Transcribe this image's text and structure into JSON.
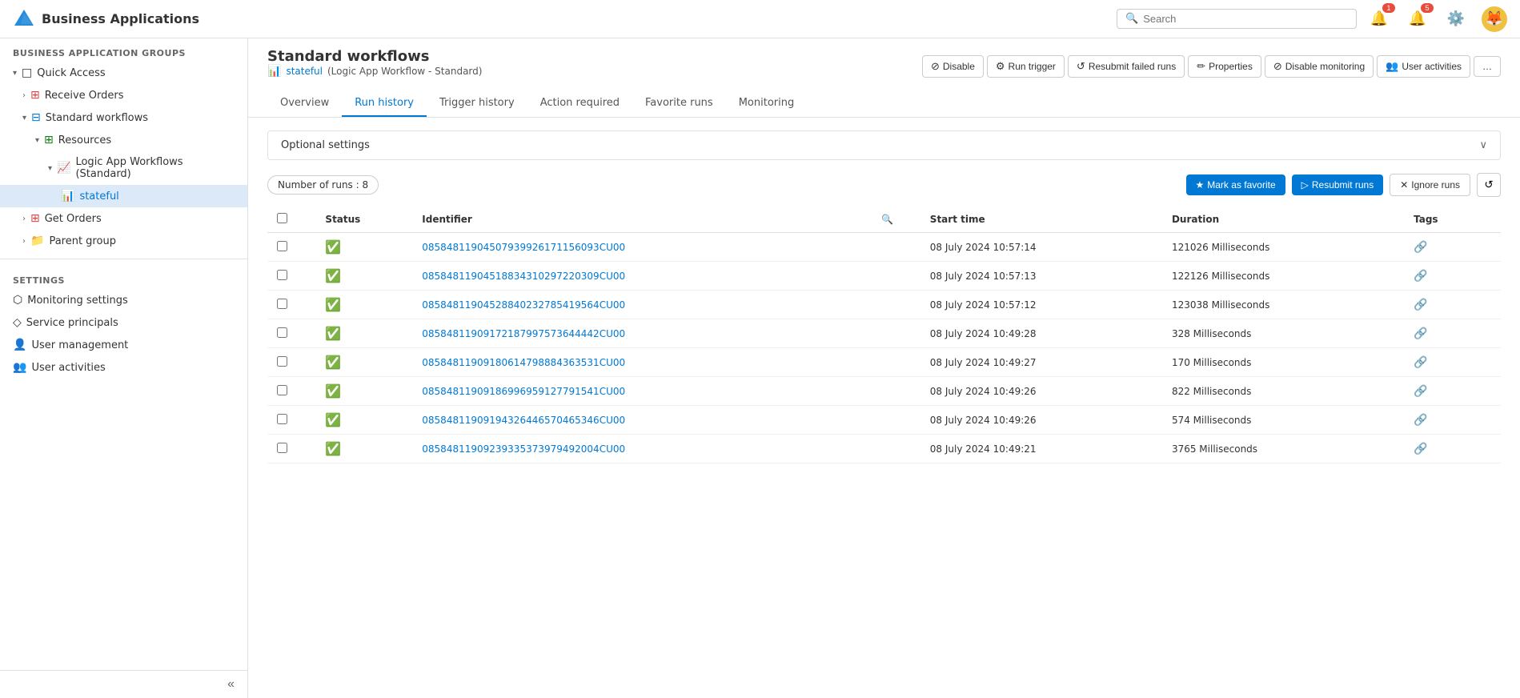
{
  "app": {
    "title": "Business Applications",
    "logo_emoji": "🔷"
  },
  "header": {
    "search_placeholder": "Search",
    "notification_badge": "1",
    "alert_badge": "5",
    "avatar_emoji": "🦊"
  },
  "sidebar": {
    "groups_title": "BUSINESS APPLICATION GROUPS",
    "quick_access_label": "Quick Access",
    "items": [
      {
        "label": "Receive Orders",
        "icon": "📊",
        "indent": 1,
        "expandable": false
      },
      {
        "label": "Standard workflows",
        "icon": "📋",
        "indent": 1,
        "expandable": true
      },
      {
        "label": "Resources",
        "icon": "🔲",
        "indent": 2,
        "expandable": true
      },
      {
        "label": "Logic App Workflows (Standard)",
        "icon": "📈",
        "indent": 3,
        "expandable": true
      },
      {
        "label": "stateful",
        "icon": "📊",
        "indent": 4,
        "active": true
      },
      {
        "label": "Get Orders",
        "icon": "📊",
        "indent": 1,
        "expandable": false
      },
      {
        "label": "Parent group",
        "icon": "📁",
        "indent": 1,
        "expandable": false
      }
    ],
    "settings_title": "SETTINGS",
    "settings_items": [
      {
        "label": "Monitoring settings",
        "icon": "⬡"
      },
      {
        "label": "Service principals",
        "icon": "◇"
      },
      {
        "label": "User management",
        "icon": "👤"
      },
      {
        "label": "User activities",
        "icon": "👥"
      }
    ],
    "collapse_tooltip": "Collapse"
  },
  "page": {
    "title": "Standard workflows",
    "subtitle_name": "stateful",
    "subtitle_detail": "(Logic App Workflow - Standard)",
    "toolbar": [
      {
        "label": "Disable",
        "icon": "⊘",
        "key": "disable"
      },
      {
        "label": "Run trigger",
        "icon": "⚙",
        "key": "run-trigger"
      },
      {
        "label": "Resubmit failed runs",
        "icon": "↺",
        "key": "resubmit-failed"
      },
      {
        "label": "Properties",
        "icon": "✏",
        "key": "properties"
      },
      {
        "label": "Disable monitoring",
        "icon": "⊘",
        "key": "disable-monitoring"
      },
      {
        "label": "User activities",
        "icon": "👥",
        "key": "user-activities"
      }
    ],
    "more_icon": "…"
  },
  "tabs": [
    {
      "label": "Overview",
      "key": "overview",
      "active": false
    },
    {
      "label": "Run history",
      "key": "run-history",
      "active": true
    },
    {
      "label": "Trigger history",
      "key": "trigger-history",
      "active": false
    },
    {
      "label": "Action required",
      "key": "action-required",
      "active": false
    },
    {
      "label": "Favorite runs",
      "key": "favorite-runs",
      "active": false
    },
    {
      "label": "Monitoring",
      "key": "monitoring",
      "active": false
    }
  ],
  "run_history": {
    "optional_settings_label": "Optional settings",
    "number_of_runs_label": "Number of runs : 8",
    "mark_favorite_label": "Mark as favorite",
    "resubmit_runs_label": "Resubmit runs",
    "ignore_runs_label": "Ignore runs",
    "columns": [
      {
        "label": "Status"
      },
      {
        "label": "Identifier"
      },
      {
        "label": ""
      },
      {
        "label": "Start time"
      },
      {
        "label": "Duration"
      },
      {
        "label": "Tags"
      }
    ],
    "runs": [
      {
        "id": "08584811904507939926171156093CU00",
        "start_time": "08 July 2024 10:57:14",
        "duration": "121026 Milliseconds",
        "status": "success"
      },
      {
        "id": "08584811904518834310297220309CU00",
        "start_time": "08 July 2024 10:57:13",
        "duration": "122126 Milliseconds",
        "status": "success"
      },
      {
        "id": "08584811904528840232785419564CU00",
        "start_time": "08 July 2024 10:57:12",
        "duration": "123038 Milliseconds",
        "status": "success"
      },
      {
        "id": "08584811909172187997573644442CU00",
        "start_time": "08 July 2024 10:49:28",
        "duration": "328 Milliseconds",
        "status": "success"
      },
      {
        "id": "08584811909180614798884363531CU00",
        "start_time": "08 July 2024 10:49:27",
        "duration": "170 Milliseconds",
        "status": "success"
      },
      {
        "id": "08584811909186996959127791541CU00",
        "start_time": "08 July 2024 10:49:26",
        "duration": "822 Milliseconds",
        "status": "success"
      },
      {
        "id": "08584811909194326446570465346CU00",
        "start_time": "08 July 2024 10:49:26",
        "duration": "574 Milliseconds",
        "status": "success"
      },
      {
        "id": "08584811909239335373979492004CU00",
        "start_time": "08 July 2024 10:49:21",
        "duration": "3765 Milliseconds",
        "status": "success"
      }
    ]
  }
}
